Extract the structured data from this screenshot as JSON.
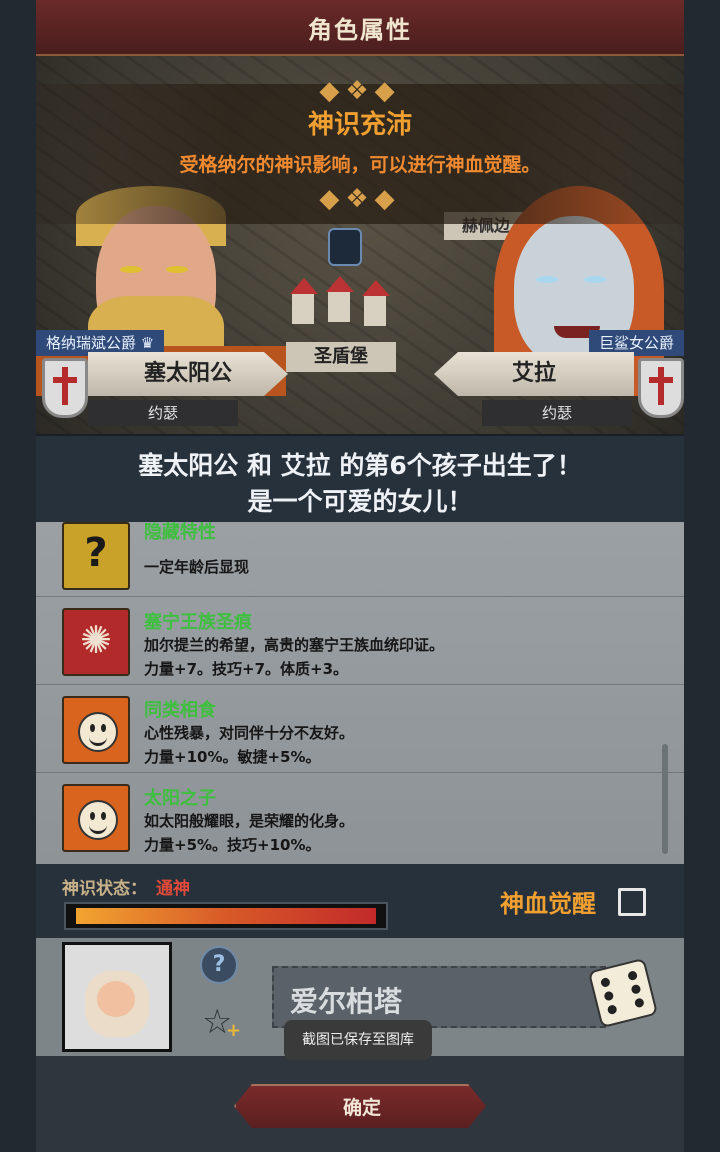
{
  "header": {
    "title": "角色属性"
  },
  "event": {
    "title": "神识充沛",
    "description": "受格纳尔的神识影响，可以进行神血觉醒。"
  },
  "map": {
    "town_label": "圣盾堡",
    "region_label": "赫佩边"
  },
  "father": {
    "title": "格纳瑞斌公爵",
    "name": "塞太阳公",
    "faith": "约瑟"
  },
  "mother": {
    "title": "巨鲨女公爵",
    "name": "艾拉",
    "faith": "约瑟"
  },
  "announcement": {
    "line1": "塞太阳公 和 艾拉 的第6个孩子出生了！",
    "line2": "是一个可爱的女儿！"
  },
  "traits": [
    {
      "name": "隐藏特性",
      "desc1": "",
      "desc2": "一定年龄后显现",
      "icon": "question-mark-icon",
      "color": "#c9a22a"
    },
    {
      "name": "塞宁王族圣痕",
      "desc1": "加尔提兰的希望，高贵的塞宁王族血统印证。",
      "desc2": "力量+7。技巧+7。体质+3。",
      "icon": "sun-sigil-icon",
      "color": "#b32a2a"
    },
    {
      "name": "同类相食",
      "desc1": "心性残暴，对同伴十分不友好。",
      "desc2": "力量+10%。敏捷+5%。",
      "icon": "smiley-face-icon",
      "color": "#d8641e"
    },
    {
      "name": "太阳之子",
      "desc1": "如太阳般耀眼，是荣耀的化身。",
      "desc2": "力量+5%。技巧+10%。",
      "icon": "smiley-face-icon",
      "color": "#d8641e"
    }
  ],
  "status": {
    "label": "神识状态：",
    "value": "通神",
    "bar_fill": 1.0,
    "awaken_label": "神血觉醒",
    "awaken_checked": false
  },
  "child": {
    "name": "爱尔柏塔"
  },
  "toast": "截图已保存至图库",
  "confirm_button": "确定",
  "colors": {
    "accent": "#f0a030",
    "trait_name": "#3fbf3f",
    "status_value": "#e04a3a"
  }
}
